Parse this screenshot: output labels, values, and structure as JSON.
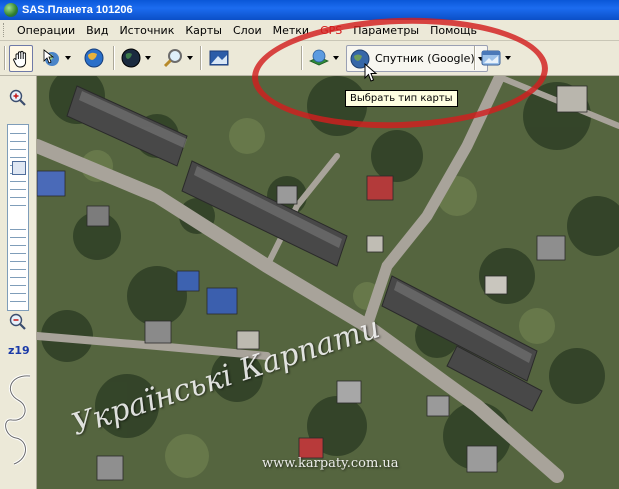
{
  "window": {
    "title": "SAS.Планета 101206"
  },
  "menu": [
    {
      "label": "Операции"
    },
    {
      "label": "Вид"
    },
    {
      "label": "Источник"
    },
    {
      "label": "Карты"
    },
    {
      "label": "Слои"
    },
    {
      "label": "Метки"
    },
    {
      "label": "GPS"
    },
    {
      "label": "Параметры"
    },
    {
      "label": "Помощь"
    }
  ],
  "toolbar": {
    "map_type_label": "Спутник (Google)",
    "tooltip": "Выбрать тип карты"
  },
  "zoom": {
    "level": "z19"
  },
  "map": {
    "watermark": "Українські Карпати",
    "url": "www.karpaty.com.ua"
  },
  "colors": {
    "titlebar": "#0a57d8",
    "gps_menu": "#d31a1a",
    "highlight_ellipse": "#d21e1e",
    "zoom_level": "#1a3aa8"
  }
}
